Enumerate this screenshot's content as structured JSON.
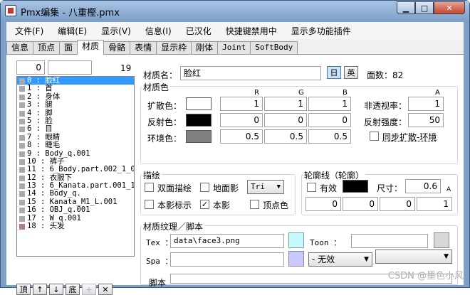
{
  "window": {
    "title": "Pmx编集 - 八重樫.pmx",
    "min": "▁",
    "max": "□",
    "close": "✕"
  },
  "menu": [
    "文件(F)",
    "编辑(E)",
    "显示(V)",
    "信息(I)",
    "已汉化",
    "快捷键禁用中",
    "显示多功能插件"
  ],
  "tabs": [
    "信息",
    "顶点",
    "面",
    "材质",
    "骨骼",
    "表情",
    "显示枠",
    "刚体",
    "Joint",
    "SoftBody"
  ],
  "list": {
    "index_value": "0",
    "count": "19",
    "items": [
      "0 : 脸红",
      "1 : 首",
      "2 : 身体",
      "3 : 腿",
      "4 : 脚",
      "5 : 脸",
      "6 : 目",
      "7 : 眼睛",
      "8 : 睫毛",
      "9 : Body_q.001",
      "10 : 裤子",
      "11 : 6_Body.part.002_1_0",
      "12 : 衣服下",
      "13 : 6_Kanata.part.001_1",
      "14 : Body_q.",
      "15 : Kanata_M1_L.001",
      "16 : OBJ_q.001",
      "17 : W_q.001",
      "18 : 头发"
    ],
    "buttons": [
      "頂",
      "↑",
      "↓",
      "底",
      "+",
      "✕"
    ]
  },
  "material": {
    "name_label": "材质名：",
    "name_value": "脸红",
    "btn_jp": "日",
    "btn_en": "英",
    "face_label": "面数：82"
  },
  "color_group": {
    "title": "材质色",
    "col_r": "R",
    "col_g": "G",
    "col_b": "B",
    "col_a": "A",
    "diffuse_label": "扩散色：",
    "diffuse": [
      "1",
      "1",
      "1"
    ],
    "specular_label": "反射色：",
    "specular": [
      "0",
      "0",
      "0"
    ],
    "ambient_label": "环境色：",
    "ambient": [
      "0.5",
      "0.5",
      "0.5"
    ],
    "alpha_label": "非透视率：",
    "alpha": "1",
    "spec_label": "反射强度：",
    "spec_power": "50",
    "sync_label": "同步扩散-环境",
    "colors": {
      "diffuse": "#ffffff",
      "specular": "#000000",
      "ambient": "#808080"
    }
  },
  "draw_group": {
    "title": "描绘",
    "double": "双面描绘",
    "ground": "地面影",
    "tri": "Tri",
    "self": "本影标示",
    "selfshadow": "本影",
    "vertex": "顶点色"
  },
  "edge_group": {
    "title": "轮廓线（轮廓）",
    "valid": "有效",
    "size_label": "尺寸：",
    "size": "0.6",
    "a_label": "A",
    "rgba": [
      "0",
      "0",
      "0",
      "1"
    ],
    "color": "#000000"
  },
  "tex_group": {
    "title": "材质纹理／脚本",
    "tex_label": "Tex ：",
    "tex_value": "data\\face3.png",
    "toon_label": "Toon ：",
    "spa_label": "Spa ：",
    "spa_mode": "- 无效",
    "script_label": "脚本",
    "colors": {
      "tex": "#c8f8ff",
      "spa": "#c8c8ff",
      "toon": "#d8d8d8"
    }
  },
  "watermark": "CSDN @墨色小风"
}
